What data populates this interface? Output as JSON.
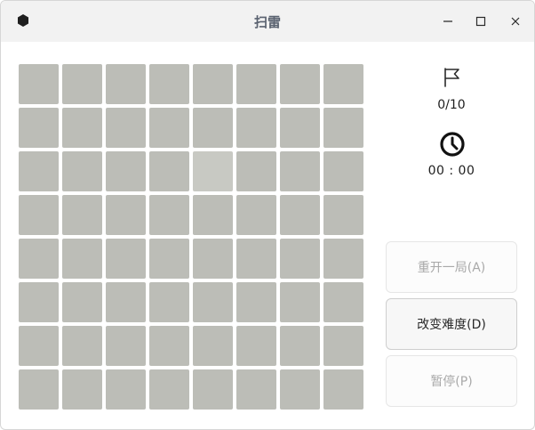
{
  "window": {
    "title": "扫雷"
  },
  "icons": {
    "app": "minesweeper-app-icon",
    "minimize": "minimize-icon",
    "maximize": "maximize-icon",
    "close": "close-icon",
    "flag": "flag-icon",
    "clock": "clock-icon"
  },
  "board": {
    "rows": 8,
    "cols": 8,
    "cell_color": "#bcbdb7",
    "hover_cell_color": "#c8c9c3",
    "hover_cell": {
      "row": 2,
      "col": 4
    }
  },
  "status": {
    "mine_count": "0/10",
    "timer": "00 : 00"
  },
  "buttons": {
    "restart": "重开一局(A)",
    "difficulty": "改变难度(D)",
    "pause": "暂停(P)"
  }
}
